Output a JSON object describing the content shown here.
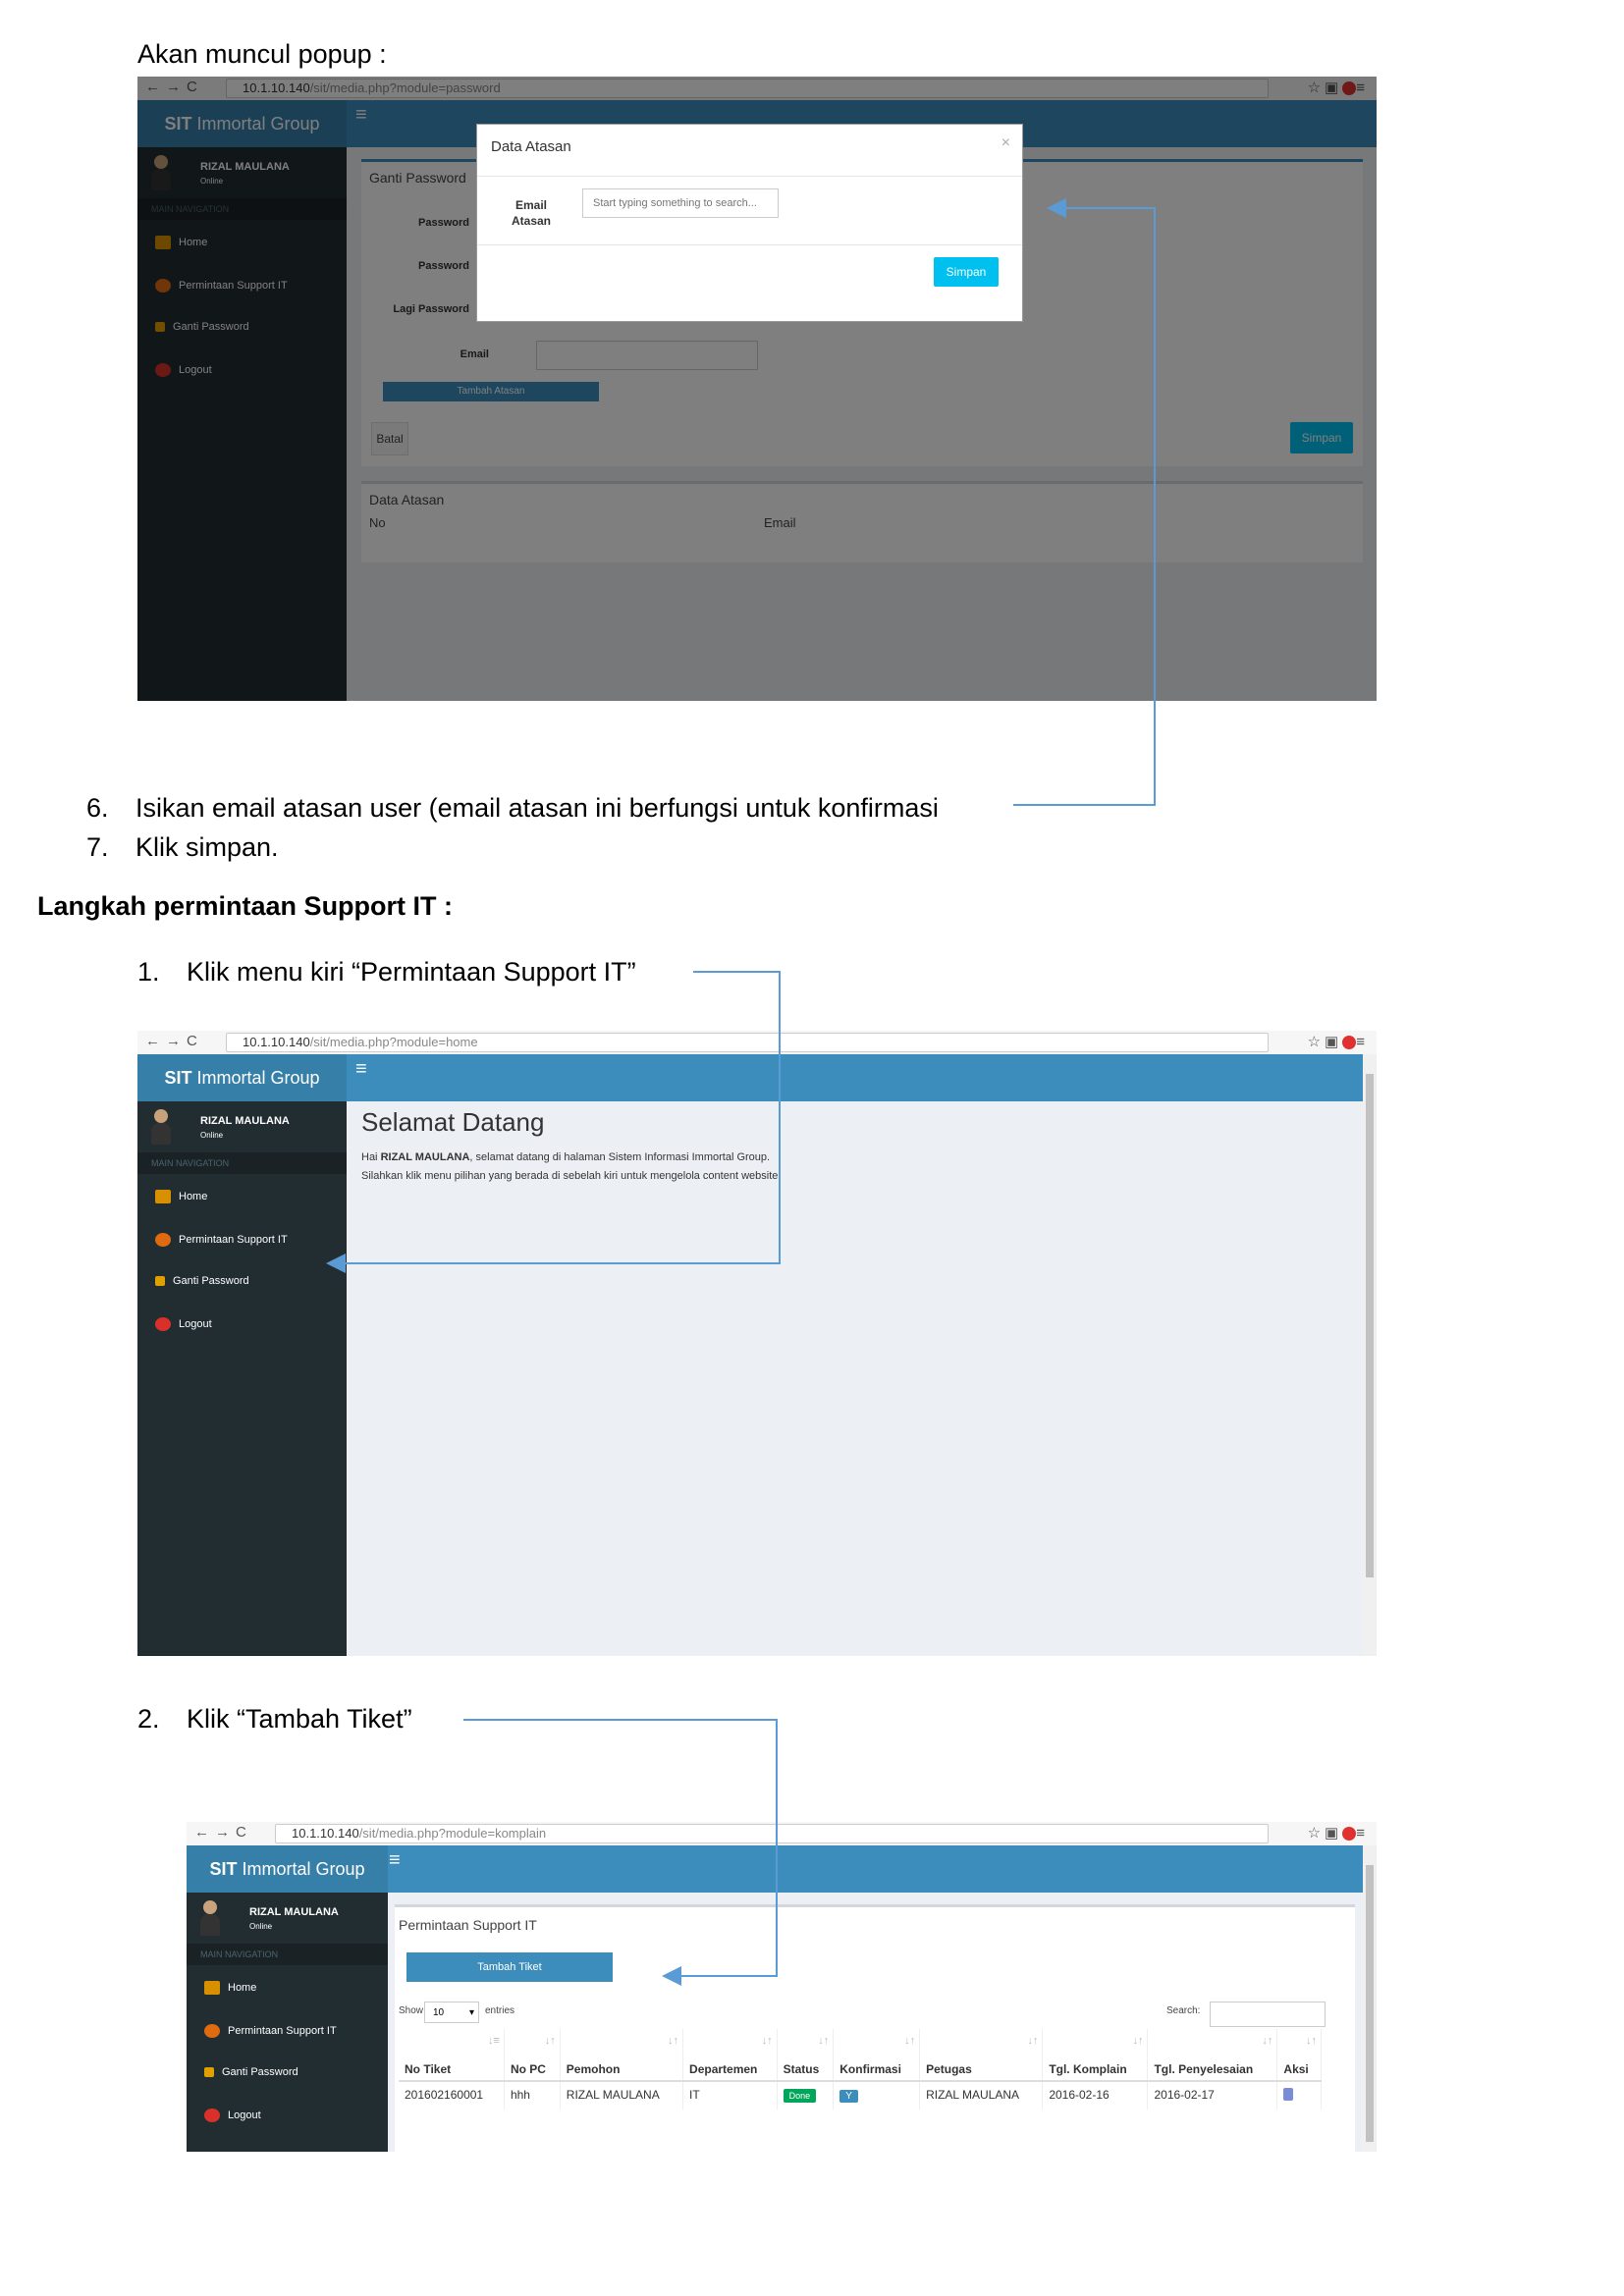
{
  "doc": {
    "intro": "Akan muncul popup :",
    "step6_num": "6.",
    "step6_text": "Isikan email atasan user (email atasan ini berfungsi untuk konfirmasi",
    "step7_num": "7.",
    "step7_text": "Klik simpan.",
    "section_title": "Langkah permintaan Support IT :",
    "s1_num": "1.",
    "s1_text": "Klik menu kiri “Permintaan Support IT”",
    "s2_num": "2.",
    "s2_text": "Klik “Tambah Tiket”"
  },
  "app": {
    "brand_bold": "SIT",
    "brand_rest": " Immortal Group",
    "user_name": "RIZAL MAULANA",
    "user_status": "Online",
    "nav_header": "MAIN NAVIGATION",
    "nav_home": "Home",
    "nav_support": "Permintaan Support IT",
    "nav_password": "Ganti Password",
    "nav_logout": "Logout"
  },
  "shot1": {
    "url_host": "10.1.10.140",
    "url_path": "/sit/media.php?module=password",
    "box_title": "Ganti Password",
    "lbl_password": "Password",
    "lbl_password2": "Password",
    "lbl_lagi": "Lagi Password",
    "lbl_email": "Email",
    "btn_tambah_atasan": "Tambah Atasan",
    "btn_batal": "Batal",
    "btn_simpan": "Simpan",
    "box2_title": "Data Atasan",
    "col_no": "No",
    "col_email": "Email",
    "modal": {
      "title": "Data Atasan",
      "close": "×",
      "label_line1": "Email",
      "label_line2": "Atasan",
      "placeholder": "Start typing something to search...",
      "save": "Simpan"
    }
  },
  "shot2": {
    "url_host": "10.1.10.140",
    "url_path": "/sit/media.php?module=home",
    "heading": "Selamat Datang",
    "p1_pre": "Hai ",
    "p1_name": "RIZAL MAULANA",
    "p1_post": ", selamat datang di halaman Sistem Informasi Immortal Group.",
    "p2": "Silahkan klik menu pilihan yang berada di sebelah kiri untuk mengelola content website."
  },
  "shot3": {
    "url_host": "10.1.10.140",
    "url_path": "/sit/media.php?module=komplain",
    "box_title": "Permintaan Support IT",
    "btn_tambah": "Tambah Tiket",
    "show": "Show",
    "entries_value": "10",
    "entries": "entries",
    "search": "Search:",
    "columns": [
      "No Tiket",
      "No PC",
      "Pemohon",
      "Departemen",
      "Status",
      "Konfirmasi",
      "Petugas",
      "Tgl. Komplain",
      "Tgl. Penyelesaian",
      "Aksi"
    ],
    "row": {
      "no_tiket": "201602160001",
      "no_pc": "hhh",
      "pemohon": "RIZAL MAULANA",
      "departemen": "IT",
      "status": "Done",
      "konfirmasi": "Y",
      "petugas": "RIZAL MAULANA",
      "tgl_komplain": "2016-02-16",
      "tgl_penyelesaian": "2016-02-17"
    }
  },
  "colors": {
    "header": "#3c8dbc",
    "sidebar": "#222d32",
    "arrow": "#5b9bd5"
  }
}
